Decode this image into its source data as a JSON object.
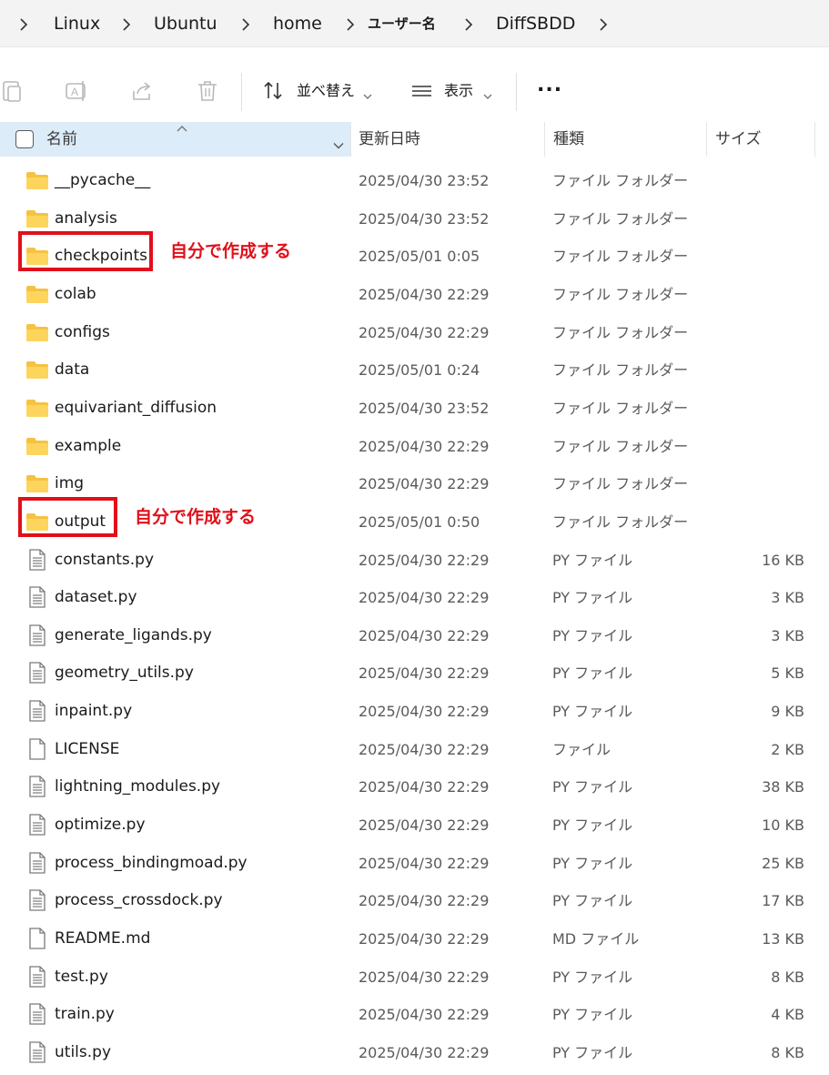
{
  "breadcrumb": {
    "items": [
      "Linux",
      "Ubuntu",
      "home",
      "ユーザー名",
      "DiffSBDD"
    ]
  },
  "toolbar": {
    "sort_label": "並べ替え",
    "view_label": "表示",
    "more_label": "..."
  },
  "columns": {
    "name": "名前",
    "date": "更新日時",
    "type": "種類",
    "size": "サイズ"
  },
  "annotation": {
    "text": "自分で作成する",
    "color": "#e0101a"
  },
  "files": [
    {
      "name": "__pycache__",
      "date": "2025/04/30 23:52",
      "type": "ファイル フォルダー",
      "size": "",
      "kind": "folder"
    },
    {
      "name": "analysis",
      "date": "2025/04/30 23:52",
      "type": "ファイル フォルダー",
      "size": "",
      "kind": "folder"
    },
    {
      "name": "checkpoints",
      "date": "2025/05/01 0:05",
      "type": "ファイル フォルダー",
      "size": "",
      "kind": "folder",
      "highlight": true
    },
    {
      "name": "colab",
      "date": "2025/04/30 22:29",
      "type": "ファイル フォルダー",
      "size": "",
      "kind": "folder"
    },
    {
      "name": "configs",
      "date": "2025/04/30 22:29",
      "type": "ファイル フォルダー",
      "size": "",
      "kind": "folder"
    },
    {
      "name": "data",
      "date": "2025/05/01 0:24",
      "type": "ファイル フォルダー",
      "size": "",
      "kind": "folder"
    },
    {
      "name": "equivariant_diffusion",
      "date": "2025/04/30 23:52",
      "type": "ファイル フォルダー",
      "size": "",
      "kind": "folder"
    },
    {
      "name": "example",
      "date": "2025/04/30 22:29",
      "type": "ファイル フォルダー",
      "size": "",
      "kind": "folder"
    },
    {
      "name": "img",
      "date": "2025/04/30 22:29",
      "type": "ファイル フォルダー",
      "size": "",
      "kind": "folder"
    },
    {
      "name": "output",
      "date": "2025/05/01 0:50",
      "type": "ファイル フォルダー",
      "size": "",
      "kind": "folder",
      "highlight": true
    },
    {
      "name": "constants.py",
      "date": "2025/04/30 22:29",
      "type": "PY ファイル",
      "size": "16 KB",
      "kind": "text"
    },
    {
      "name": "dataset.py",
      "date": "2025/04/30 22:29",
      "type": "PY ファイル",
      "size": "3 KB",
      "kind": "text"
    },
    {
      "name": "generate_ligands.py",
      "date": "2025/04/30 22:29",
      "type": "PY ファイル",
      "size": "3 KB",
      "kind": "text"
    },
    {
      "name": "geometry_utils.py",
      "date": "2025/04/30 22:29",
      "type": "PY ファイル",
      "size": "5 KB",
      "kind": "text"
    },
    {
      "name": "inpaint.py",
      "date": "2025/04/30 22:29",
      "type": "PY ファイル",
      "size": "9 KB",
      "kind": "text"
    },
    {
      "name": "LICENSE",
      "date": "2025/04/30 22:29",
      "type": "ファイル",
      "size": "2 KB",
      "kind": "blank"
    },
    {
      "name": "lightning_modules.py",
      "date": "2025/04/30 22:29",
      "type": "PY ファイル",
      "size": "38 KB",
      "kind": "text"
    },
    {
      "name": "optimize.py",
      "date": "2025/04/30 22:29",
      "type": "PY ファイル",
      "size": "10 KB",
      "kind": "text"
    },
    {
      "name": "process_bindingmoad.py",
      "date": "2025/04/30 22:29",
      "type": "PY ファイル",
      "size": "25 KB",
      "kind": "text"
    },
    {
      "name": "process_crossdock.py",
      "date": "2025/04/30 22:29",
      "type": "PY ファイル",
      "size": "17 KB",
      "kind": "text"
    },
    {
      "name": "README.md",
      "date": "2025/04/30 22:29",
      "type": "MD ファイル",
      "size": "13 KB",
      "kind": "blank"
    },
    {
      "name": "test.py",
      "date": "2025/04/30 22:29",
      "type": "PY ファイル",
      "size": "8 KB",
      "kind": "text"
    },
    {
      "name": "train.py",
      "date": "2025/04/30 22:29",
      "type": "PY ファイル",
      "size": "4 KB",
      "kind": "text"
    },
    {
      "name": "utils.py",
      "date": "2025/04/30 22:29",
      "type": "PY ファイル",
      "size": "8 KB",
      "kind": "text"
    }
  ]
}
